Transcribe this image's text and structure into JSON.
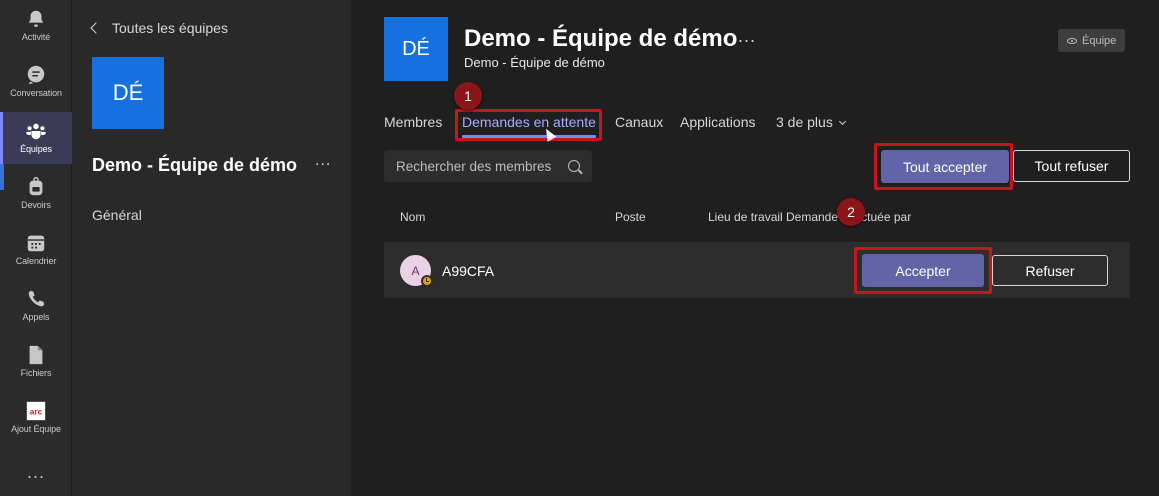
{
  "app_rail": {
    "items": [
      {
        "label": "Activité",
        "icon": "bell-icon"
      },
      {
        "label": "Conversation",
        "icon": "chat-icon"
      },
      {
        "label": "Équipes",
        "icon": "teams-icon",
        "active": true
      },
      {
        "label": "Devoirs",
        "icon": "backpack-icon"
      },
      {
        "label": "Calendrier",
        "icon": "calendar-icon"
      },
      {
        "label": "Appels",
        "icon": "phone-icon"
      },
      {
        "label": "Fichiers",
        "icon": "file-icon"
      },
      {
        "label": "Ajout Équipe",
        "icon": "arc-app-icon"
      }
    ],
    "more": "..."
  },
  "panel": {
    "back_label": "Toutes les équipes",
    "avatar_initials": "DÉ",
    "team_name": "Demo - Équipe de démo",
    "more": "...",
    "channel": "Général"
  },
  "header": {
    "avatar_initials": "DÉ",
    "title": "Demo - Équipe de démo",
    "more": "...",
    "subtitle": "Demo - Équipe de démo",
    "visibility": "Équipe"
  },
  "tabs": [
    {
      "label": "Membres"
    },
    {
      "label": "Demandes en attente",
      "active": true
    },
    {
      "label": "Canaux"
    },
    {
      "label": "Applications"
    },
    {
      "label": "3 de plus"
    }
  ],
  "search": {
    "placeholder": "Rechercher des membres"
  },
  "actions": {
    "accept_all": "Tout accepter",
    "refuse_all": "Tout refuser"
  },
  "columns": [
    "Nom",
    "Poste",
    "Lieu de travail",
    "Demande effectuée par"
  ],
  "rows": [
    {
      "initial": "A",
      "name": "A99CFA",
      "accept": "Accepter",
      "refuse": "Refuser"
    }
  ],
  "steps": [
    "1",
    "2"
  ],
  "colors": {
    "accent": "#6264a7",
    "highlight": "#c4161c",
    "avatar": "#1570e0"
  }
}
